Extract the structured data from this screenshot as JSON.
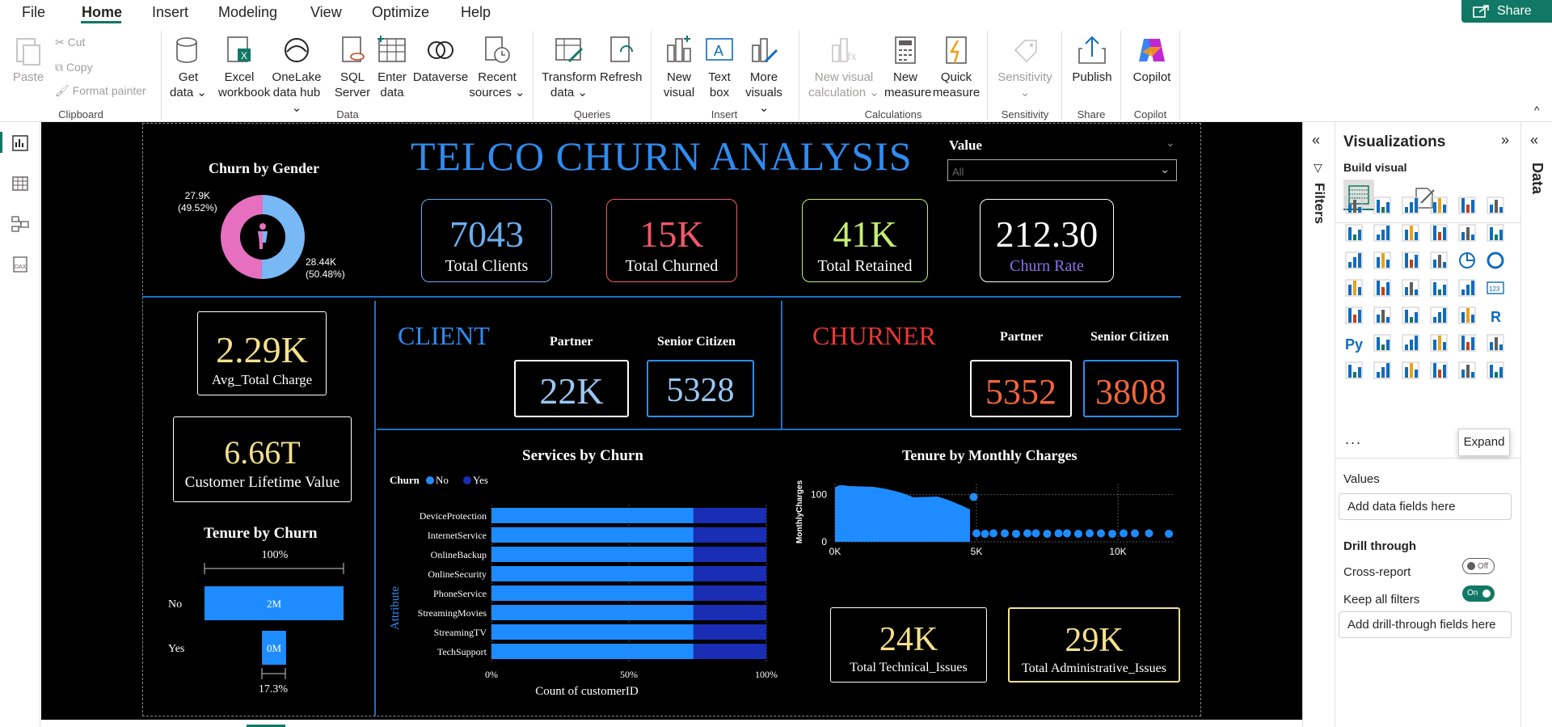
{
  "menu": {
    "items": [
      "File",
      "Home",
      "Insert",
      "Modeling",
      "View",
      "Optimize",
      "Help"
    ],
    "active": "Home",
    "share": "Share"
  },
  "ribbon": {
    "clipboard": {
      "paste": "Paste",
      "cut": "Cut",
      "copy": "Copy",
      "format_painter": "Format painter",
      "group": "Clipboard"
    },
    "data": {
      "get_data": [
        "Get",
        "data"
      ],
      "excel": [
        "Excel",
        "workbook"
      ],
      "onelake": [
        "OneLake",
        "data hub"
      ],
      "sql": [
        "SQL",
        "Server"
      ],
      "enter": [
        "Enter",
        "data"
      ],
      "dataverse": "Dataverse",
      "recent": [
        "Recent",
        "sources"
      ],
      "group": "Data"
    },
    "queries": {
      "transform": [
        "Transform",
        "data"
      ],
      "refresh": "Refresh",
      "group": "Queries"
    },
    "insert": {
      "new_visual": [
        "New",
        "visual"
      ],
      "text_box": [
        "Text",
        "box"
      ],
      "more_visuals": [
        "More",
        "visuals"
      ],
      "group": "Insert"
    },
    "calculations": {
      "new_visual_calc": [
        "New visual",
        "calculation"
      ],
      "new_measure": [
        "New",
        "measure"
      ],
      "quick_measure": [
        "Quick",
        "measure"
      ],
      "group": "Calculations"
    },
    "sensitivity": {
      "label": "Sensitivity",
      "group": "Sensitivity"
    },
    "share": {
      "publish": "Publish",
      "group": "Share"
    },
    "copilot": {
      "label": "Copilot",
      "group": "Copilot"
    }
  },
  "report": {
    "title": "TELCO CHURN ANALYSIS",
    "slicer": {
      "label": "Value",
      "placeholder": "All"
    },
    "gender_chart": {
      "title": "Churn by Gender",
      "left_label": [
        "27.9K",
        "(49.52%)"
      ],
      "right_label": [
        "28.44K",
        "(50.48%)"
      ]
    },
    "kpis": [
      {
        "value": "7043",
        "caption": "Total Clients",
        "color": "#6aaef0"
      },
      {
        "value": "15K",
        "caption": "Total Churned",
        "color": "#f0586a"
      },
      {
        "value": "41K",
        "caption": "Total Retained",
        "color": "#c4ef74"
      },
      {
        "value": "212.30",
        "caption": "Churn Rate",
        "color": "#ffffff",
        "caption_color": "#8e6ff0"
      }
    ],
    "avg_total_charge": {
      "value": "2.29K",
      "caption": "Avg_Total Charge"
    },
    "clv": {
      "value": "6.66T",
      "caption": "Customer Lifetime Value"
    },
    "client": {
      "heading": "CLIENT",
      "partner_label": "Partner",
      "senior_label": "Senior Citizen",
      "partner": "22K",
      "senior": "5328"
    },
    "churner": {
      "heading": "CHURNER",
      "partner_label": "Partner",
      "senior_label": "Senior Citizen",
      "partner": "5352",
      "senior": "3808"
    },
    "tenure_by_churn": {
      "title": "Tenure by Churn",
      "top_label": "100%",
      "bottom_label": "17.3%"
    },
    "services_chart": {
      "title": "Services by Churn",
      "legend_title": "Churn",
      "ylabel": "Attribute",
      "xlabel": "Count of customerID"
    },
    "scatter_chart": {
      "title": "Tenure by Monthly Charges",
      "ylabel": "MonthlyCharges"
    },
    "technical": {
      "value": "24K",
      "caption": "Total Technical_Issues"
    },
    "administrative": {
      "value": "29K",
      "caption": "Total Administrative_Issues"
    }
  },
  "chart_data": [
    {
      "type": "pie",
      "title": "Churn by Gender",
      "slices": [
        {
          "label": "27.9K (49.52%)",
          "value": 27.9,
          "color": "#e66fc0"
        },
        {
          "label": "28.44K (50.48%)",
          "value": 28.44,
          "color": "#78b8f5"
        }
      ]
    },
    {
      "type": "bar",
      "title": "Tenure by Churn",
      "categories": [
        "No",
        "Yes"
      ],
      "values": [
        100,
        17.3
      ],
      "data_labels": [
        "2M",
        "0M"
      ],
      "color": "#1e8cff"
    },
    {
      "type": "bar",
      "title": "Services by Churn",
      "stacked_percent": true,
      "categories": [
        "DeviceProtection",
        "InternetService",
        "OnlineBackup",
        "OnlineSecurity",
        "PhoneService",
        "StreamingMovies",
        "StreamingTV",
        "TechSupport"
      ],
      "series": [
        {
          "name": "No",
          "values": [
            73.5,
            73.5,
            73.5,
            73.5,
            73.5,
            73.5,
            73.5,
            73.5
          ],
          "color": "#1e8cff"
        },
        {
          "name": "Yes",
          "values": [
            26.5,
            26.5,
            26.5,
            26.5,
            26.5,
            26.5,
            26.5,
            26.5
          ],
          "color": "#1a2db5"
        }
      ],
      "xticks": [
        "0%",
        "50%",
        "100%"
      ],
      "xlabel": "Count of customerID",
      "ylabel": "Attribute"
    },
    {
      "type": "scatter",
      "title": "Tenure by Monthly Charges",
      "ylabel": "MonthlyCharges",
      "xlim": [
        0,
        12000
      ],
      "ylim": [
        0,
        120
      ],
      "xticks": [
        "0K",
        "5K",
        "10K"
      ],
      "yticks": [
        "0",
        "100"
      ],
      "points": [
        [
          4900,
          95
        ],
        [
          5000,
          18
        ],
        [
          5300,
          17
        ],
        [
          5600,
          18
        ],
        [
          6000,
          18
        ],
        [
          6400,
          17
        ],
        [
          6800,
          18
        ],
        [
          7100,
          18
        ],
        [
          7500,
          17
        ],
        [
          7900,
          18
        ],
        [
          8200,
          18
        ],
        [
          8600,
          17
        ],
        [
          9000,
          18
        ],
        [
          9400,
          18
        ],
        [
          9800,
          17
        ],
        [
          10200,
          18
        ],
        [
          10600,
          18
        ],
        [
          11100,
          18
        ],
        [
          11800,
          17
        ]
      ],
      "color": "#1e8cff"
    }
  ],
  "viz_pane": {
    "title": "Visualizations",
    "build_visual": "Build visual",
    "tooltip": "Expand",
    "more": "...",
    "values_label": "Values",
    "values_placeholder": "Add data fields here",
    "drill_through": "Drill through",
    "cross_report": "Cross-report",
    "cross_report_state": "Off",
    "keep_filters": "Keep all filters",
    "keep_filters_state": "On",
    "drill_placeholder": "Add drill-through fields here"
  },
  "filters_label": "Filters",
  "data_label": "Data"
}
